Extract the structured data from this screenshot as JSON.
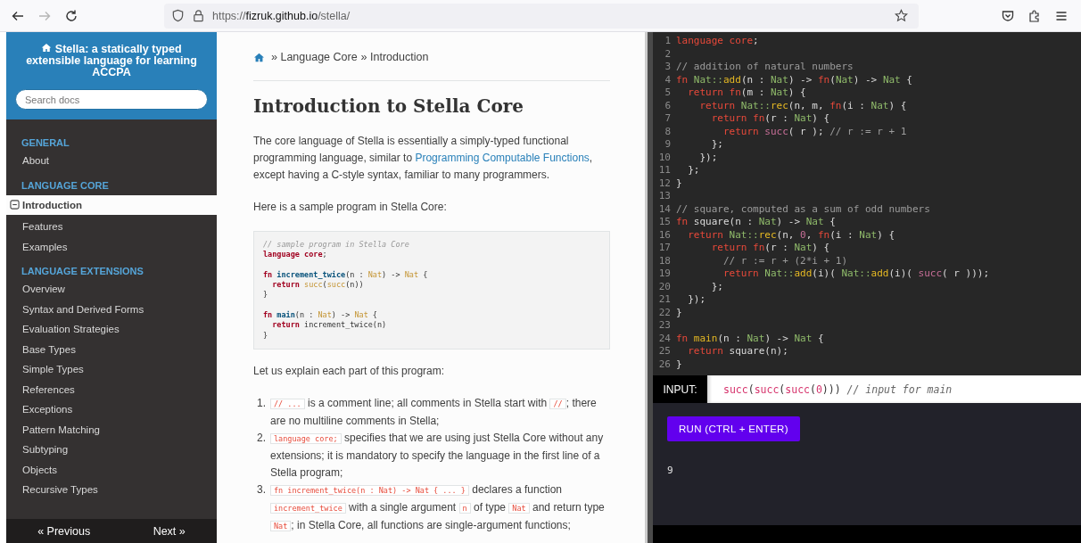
{
  "browser": {
    "back": {
      "disabled": false
    },
    "forward": {
      "disabled": true
    },
    "url": {
      "scheme": "https://",
      "host": "fizruk.github.io",
      "path": "/stella/"
    }
  },
  "sidebar": {
    "title": "Stella: a statically typed extensible language for learning ACCPA",
    "search": {
      "placeholder": "Search docs"
    },
    "sections": [
      {
        "title": "GENERAL",
        "items": [
          {
            "label": "About",
            "selected": false
          }
        ]
      },
      {
        "title": "LANGUAGE CORE",
        "items": [
          {
            "label": "Introduction",
            "selected": true
          },
          {
            "label": "Features",
            "selected": false
          },
          {
            "label": "Examples",
            "selected": false
          }
        ]
      },
      {
        "title": "LANGUAGE EXTENSIONS",
        "items": [
          {
            "label": "Overview",
            "selected": false
          },
          {
            "label": "Syntax and Derived Forms",
            "selected": false
          },
          {
            "label": "Evaluation Strategies",
            "selected": false
          },
          {
            "label": "Base Types",
            "selected": false
          },
          {
            "label": "Simple Types",
            "selected": false
          },
          {
            "label": "References",
            "selected": false
          },
          {
            "label": "Exceptions",
            "selected": false
          },
          {
            "label": "Pattern Matching",
            "selected": false
          },
          {
            "label": "Subtyping",
            "selected": false
          },
          {
            "label": "Objects",
            "selected": false
          },
          {
            "label": "Recursive Types",
            "selected": false
          }
        ]
      }
    ],
    "footer": {
      "previous": "« Previous",
      "next": "Next »"
    }
  },
  "content": {
    "breadcrumb": [
      "» Language Core",
      "» Introduction"
    ],
    "heading": "Introduction to Stella Core",
    "intro": [
      {
        "kind": "text",
        "text": "The core language of Stella is essentially a simply-typed functional programming language, similar to "
      },
      {
        "kind": "link",
        "text": "Programming Computable Functions"
      },
      {
        "kind": "text",
        "text": ", except having a C-style syntax, familiar to many programmers."
      }
    ],
    "sample_intro": "Here is a sample program in Stella Core:",
    "sample_code": [
      {
        "kind": "code",
        "tokens": [
          {
            "kind": "comment",
            "text": "// sample program in Stella Core"
          }
        ]
      },
      {
        "kind": "code",
        "tokens": [
          {
            "kind": "keyword",
            "text": "language core"
          },
          {
            "kind": "plain",
            "text": ";"
          }
        ]
      },
      {
        "kind": "blank"
      },
      {
        "kind": "code",
        "tokens": [
          {
            "kind": "keyword",
            "text": "fn"
          },
          {
            "kind": "function",
            "text": " increment_twice"
          },
          {
            "kind": "plain",
            "text": "(n : "
          },
          {
            "kind": "type",
            "text": "Nat"
          },
          {
            "kind": "plain",
            "text": ") -> "
          },
          {
            "kind": "type",
            "text": "Nat"
          },
          {
            "kind": "plain",
            "text": " {"
          }
        ]
      },
      {
        "kind": "code",
        "tokens": [
          {
            "kind": "keyword",
            "text": "  return"
          },
          {
            "kind": "builtin",
            "text": " succ"
          },
          {
            "kind": "plain",
            "text": "("
          },
          {
            "kind": "builtin",
            "text": "succ"
          },
          {
            "kind": "plain",
            "text": "(n))"
          }
        ]
      },
      {
        "kind": "code",
        "tokens": [
          {
            "kind": "plain",
            "text": "}"
          }
        ]
      },
      {
        "kind": "blank"
      },
      {
        "kind": "code",
        "tokens": [
          {
            "kind": "keyword",
            "text": "fn"
          },
          {
            "kind": "function",
            "text": " main"
          },
          {
            "kind": "plain",
            "text": "(n : "
          },
          {
            "kind": "type",
            "text": "Nat"
          },
          {
            "kind": "plain",
            "text": ") -> "
          },
          {
            "kind": "type",
            "text": "Nat"
          },
          {
            "kind": "plain",
            "text": " {"
          }
        ]
      },
      {
        "kind": "code",
        "tokens": [
          {
            "kind": "keyword",
            "text": "  return"
          },
          {
            "kind": "plain",
            "text": " increment_twice(n)"
          }
        ]
      },
      {
        "kind": "code",
        "tokens": [
          {
            "kind": "plain",
            "text": "}"
          }
        ]
      }
    ],
    "explain_intro": "Let us explain each part of this program:",
    "explain_items": [
      {
        "number": "1.",
        "segments": [
          {
            "kind": "code",
            "text": "// ..."
          },
          {
            "kind": "text",
            "text": " is a comment line; all comments in Stella start with "
          },
          {
            "kind": "code",
            "text": "//"
          },
          {
            "kind": "text",
            "text": "; there are no multiline comments in Stella;"
          }
        ]
      },
      {
        "number": "2.",
        "segments": [
          {
            "kind": "code",
            "text": "language core;"
          },
          {
            "kind": "text",
            "text": " specifies that we are using just Stella Core without any extensions; it is mandatory to specify the language in the first line of a Stella program;"
          }
        ]
      },
      {
        "number": "3.",
        "segments": [
          {
            "kind": "code",
            "text": "fn increment_twice(n : Nat) -> Nat { ... }"
          },
          {
            "kind": "text",
            "text": " declares a function "
          },
          {
            "kind": "code",
            "text": "increment_twice"
          },
          {
            "kind": "text",
            "text": " with a single argument "
          },
          {
            "kind": "code",
            "text": "n"
          },
          {
            "kind": "text",
            "text": " of type "
          },
          {
            "kind": "code",
            "text": "Nat"
          },
          {
            "kind": "text",
            "text": " and return type "
          },
          {
            "kind": "code",
            "text": "Nat"
          },
          {
            "kind": "text",
            "text": "; in Stella Core, all functions are single-argument functions;"
          }
        ]
      }
    ]
  },
  "editor": {
    "lines": [
      {
        "n": "1",
        "tokens": [
          {
            "kind": "keyword",
            "text": "language core"
          },
          {
            "kind": "plain",
            "text": ";"
          }
        ]
      },
      {
        "n": "2"
      },
      {
        "n": "3",
        "tokens": [
          {
            "kind": "comment",
            "text": "// addition of natural numbers"
          }
        ]
      },
      {
        "n": "4",
        "tokens": [
          {
            "kind": "keyword",
            "text": "fn"
          },
          {
            "kind": "type",
            "text": " Nat::"
          },
          {
            "kind": "function",
            "text": "add"
          },
          {
            "kind": "plain",
            "text": "(n : "
          },
          {
            "kind": "type",
            "text": "Nat"
          },
          {
            "kind": "plain",
            "text": ") -> "
          },
          {
            "kind": "keyword",
            "text": "fn"
          },
          {
            "kind": "plain",
            "text": "("
          },
          {
            "kind": "type",
            "text": "Nat"
          },
          {
            "kind": "plain",
            "text": ") -> "
          },
          {
            "kind": "type",
            "text": "Nat"
          },
          {
            "kind": "plain",
            "text": " {"
          }
        ]
      },
      {
        "n": "5",
        "tokens": [
          {
            "kind": "keyword",
            "text": "  return fn"
          },
          {
            "kind": "plain",
            "text": "(m : "
          },
          {
            "kind": "type",
            "text": "Nat"
          },
          {
            "kind": "plain",
            "text": ") {"
          }
        ]
      },
      {
        "n": "6",
        "tokens": [
          {
            "kind": "keyword",
            "text": "    return"
          },
          {
            "kind": "type",
            "text": " Nat::"
          },
          {
            "kind": "function",
            "text": "rec"
          },
          {
            "kind": "plain",
            "text": "(n, m, "
          },
          {
            "kind": "keyword",
            "text": "fn"
          },
          {
            "kind": "plain",
            "text": "(i : "
          },
          {
            "kind": "type",
            "text": "Nat"
          },
          {
            "kind": "plain",
            "text": ") {"
          }
        ]
      },
      {
        "n": "7",
        "tokens": [
          {
            "kind": "keyword",
            "text": "      return fn"
          },
          {
            "kind": "plain",
            "text": "(r : "
          },
          {
            "kind": "type",
            "text": "Nat"
          },
          {
            "kind": "plain",
            "text": ") {"
          }
        ]
      },
      {
        "n": "8",
        "tokens": [
          {
            "kind": "keyword",
            "text": "        return"
          },
          {
            "kind": "builtin",
            "text": " succ"
          },
          {
            "kind": "plain",
            "text": "( r ); "
          },
          {
            "kind": "comment",
            "text": "// r := r + 1"
          }
        ]
      },
      {
        "n": "9",
        "tokens": [
          {
            "kind": "plain",
            "text": "      };"
          }
        ]
      },
      {
        "n": "10",
        "tokens": [
          {
            "kind": "plain",
            "text": "    });"
          }
        ]
      },
      {
        "n": "11",
        "tokens": [
          {
            "kind": "plain",
            "text": "  };"
          }
        ]
      },
      {
        "n": "12",
        "tokens": [
          {
            "kind": "plain",
            "text": "}"
          }
        ]
      },
      {
        "n": "13"
      },
      {
        "n": "14",
        "tokens": [
          {
            "kind": "comment",
            "text": "// square, computed as a sum of odd numbers"
          }
        ]
      },
      {
        "n": "15",
        "tokens": [
          {
            "kind": "keyword",
            "text": "fn"
          },
          {
            "kind": "plain",
            "text": " square(n : "
          },
          {
            "kind": "type",
            "text": "Nat"
          },
          {
            "kind": "plain",
            "text": ") -> "
          },
          {
            "kind": "type",
            "text": "Nat"
          },
          {
            "kind": "plain",
            "text": " {"
          }
        ]
      },
      {
        "n": "16",
        "tokens": [
          {
            "kind": "keyword",
            "text": "  return"
          },
          {
            "kind": "type",
            "text": " Nat::"
          },
          {
            "kind": "function",
            "text": "rec"
          },
          {
            "kind": "plain",
            "text": "(n, "
          },
          {
            "kind": "number",
            "text": "0"
          },
          {
            "kind": "plain",
            "text": ", "
          },
          {
            "kind": "keyword",
            "text": "fn"
          },
          {
            "kind": "plain",
            "text": "(i : "
          },
          {
            "kind": "type",
            "text": "Nat"
          },
          {
            "kind": "plain",
            "text": ") {"
          }
        ]
      },
      {
        "n": "17",
        "tokens": [
          {
            "kind": "keyword",
            "text": "      return fn"
          },
          {
            "kind": "plain",
            "text": "(r : "
          },
          {
            "kind": "type",
            "text": "Nat"
          },
          {
            "kind": "plain",
            "text": ") {"
          }
        ]
      },
      {
        "n": "18",
        "tokens": [
          {
            "kind": "comment",
            "text": "        // r := r + (2*i + 1)"
          }
        ]
      },
      {
        "n": "19",
        "tokens": [
          {
            "kind": "keyword",
            "text": "        return"
          },
          {
            "kind": "type",
            "text": " Nat::"
          },
          {
            "kind": "function",
            "text": "add"
          },
          {
            "kind": "plain",
            "text": "(i)( "
          },
          {
            "kind": "type",
            "text": "Nat::"
          },
          {
            "kind": "function",
            "text": "add"
          },
          {
            "kind": "plain",
            "text": "(i)( "
          },
          {
            "kind": "builtin",
            "text": "succ"
          },
          {
            "kind": "plain",
            "text": "( r )));"
          }
        ]
      },
      {
        "n": "20",
        "tokens": [
          {
            "kind": "plain",
            "text": "      };"
          }
        ]
      },
      {
        "n": "21",
        "tokens": [
          {
            "kind": "plain",
            "text": "  });"
          }
        ]
      },
      {
        "n": "22",
        "tokens": [
          {
            "kind": "plain",
            "text": "}"
          }
        ]
      },
      {
        "n": "23"
      },
      {
        "n": "24",
        "tokens": [
          {
            "kind": "keyword",
            "text": "fn"
          },
          {
            "kind": "function",
            "text": " main"
          },
          {
            "kind": "plain",
            "text": "(n : "
          },
          {
            "kind": "type",
            "text": "Nat"
          },
          {
            "kind": "plain",
            "text": ") -> "
          },
          {
            "kind": "type",
            "text": "Nat"
          },
          {
            "kind": "plain",
            "text": " {"
          }
        ]
      },
      {
        "n": "25",
        "tokens": [
          {
            "kind": "keyword",
            "text": "  return"
          },
          {
            "kind": "plain",
            "text": " square(n);"
          }
        ]
      },
      {
        "n": "26",
        "tokens": [
          {
            "kind": "plain",
            "text": "}"
          }
        ]
      }
    ],
    "input": {
      "label": "INPUT:",
      "tokens": [
        {
          "kind": "builtin",
          "text": "succ"
        },
        {
          "kind": "plain",
          "text": "("
        },
        {
          "kind": "builtin",
          "text": "succ"
        },
        {
          "kind": "plain",
          "text": "("
        },
        {
          "kind": "builtin",
          "text": "succ"
        },
        {
          "kind": "plain",
          "text": "("
        },
        {
          "kind": "number",
          "text": "0"
        },
        {
          "kind": "plain",
          "text": "))) "
        },
        {
          "kind": "comment",
          "text": "// input for main"
        }
      ]
    },
    "run_button": "RUN (CTRL + ENTER)",
    "output": "9"
  }
}
